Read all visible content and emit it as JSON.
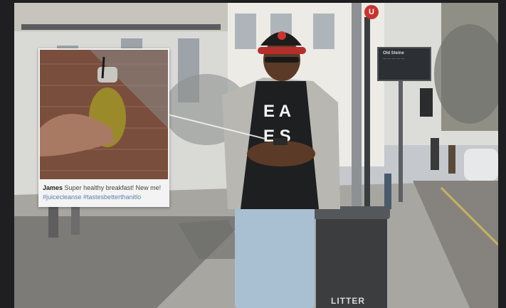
{
  "social_post": {
    "username": "James",
    "message": "Super healthy breakfast! New me!",
    "hashtags": "#juicecleanse #tastesbetterthanitlo"
  },
  "scene": {
    "tshirt_lettering": "E A\nE S",
    "litter_label": "LITTER",
    "bus_stop_badge": "U",
    "bus_sign_title": "Old Steine"
  },
  "colors": {
    "background": "#1f1f21",
    "caption_tag": "#5c7fb0",
    "juice": "#9a8a2a",
    "cap_red": "#c9332f"
  }
}
